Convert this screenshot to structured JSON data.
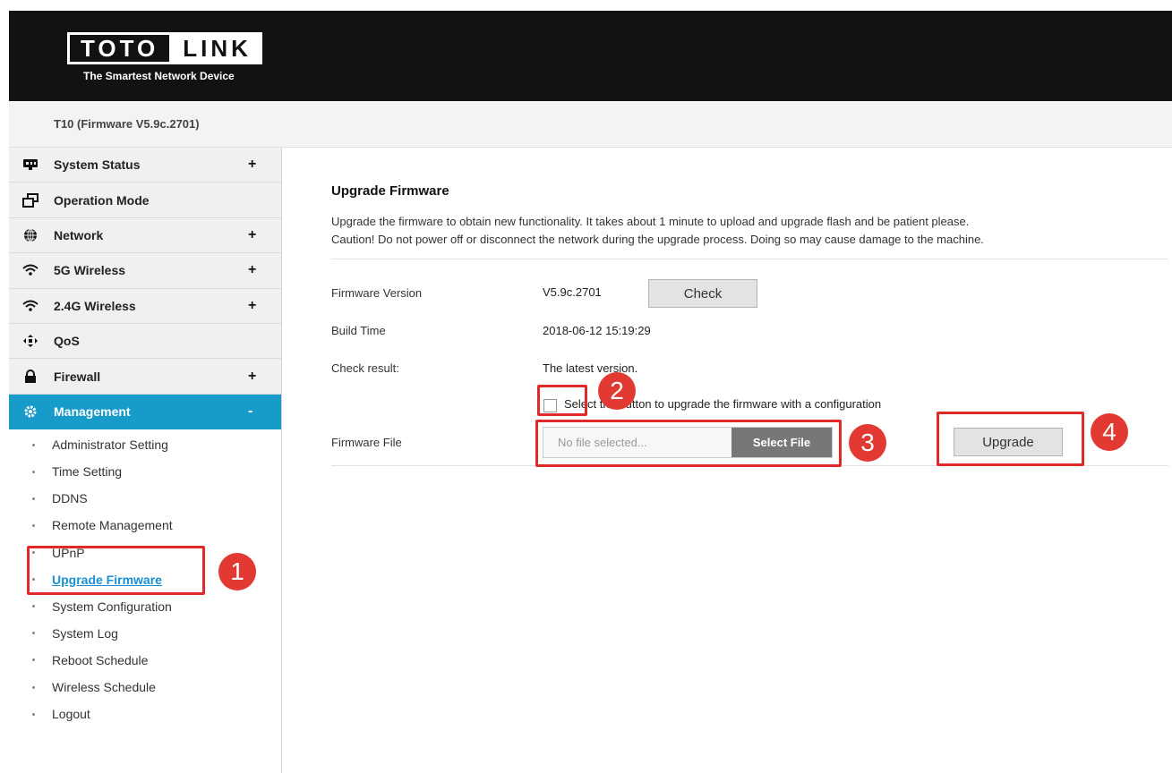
{
  "brand": {
    "logo_left": "TOTO",
    "logo_right": "LINK",
    "tagline": "The Smartest Network Device"
  },
  "model_line": "T10 (Firmware V5.9c.2701)",
  "sidebar": {
    "items": [
      {
        "label": "System Status",
        "icon": "monitor-icon",
        "expand": "+"
      },
      {
        "label": "Operation Mode",
        "icon": "mode-icon",
        "expand": ""
      },
      {
        "label": "Network",
        "icon": "globe-icon",
        "expand": "+"
      },
      {
        "label": "5G Wireless",
        "icon": "wifi-icon",
        "expand": "+"
      },
      {
        "label": "2.4G Wireless",
        "icon": "wifi-icon",
        "expand": "+"
      },
      {
        "label": "QoS",
        "icon": "qos-icon",
        "expand": ""
      },
      {
        "label": "Firewall",
        "icon": "lock-icon",
        "expand": "+"
      },
      {
        "label": "Management",
        "icon": "gear-icon",
        "expand": "-"
      }
    ],
    "submenu": [
      "Administrator Setting",
      "Time Setting",
      "DDNS",
      "Remote Management",
      "UPnP",
      "Upgrade Firmware",
      "System Configuration",
      "System Log",
      "Reboot Schedule",
      "Wireless Schedule",
      "Logout"
    ]
  },
  "main": {
    "title": "Upgrade Firmware",
    "description_1": "Upgrade the firmware to obtain new functionality. It takes about 1 minute to upload and upgrade flash and be patient please.",
    "description_2": "Caution! Do not power off or disconnect the network during the upgrade process. Doing so may cause damage to the machine.",
    "firmware_version_label": "Firmware Version",
    "firmware_version_value": "V5.9c.2701",
    "check_button": "Check",
    "build_time_label": "Build Time",
    "build_time_value": "2018-06-12 15:19:29",
    "check_result_label": "Check result:",
    "check_result_value": "The latest version.",
    "checkbox_text": "Select the button to upgrade the firmware with a configuration",
    "firmware_file_label": "Firmware File",
    "file_placeholder": "No file selected...",
    "select_file_button": "Select File",
    "upgrade_button": "Upgrade"
  },
  "annotations": {
    "badge_1": "1",
    "badge_2": "2",
    "badge_3": "3",
    "badge_4": "4",
    "color": "#e02a2a"
  }
}
